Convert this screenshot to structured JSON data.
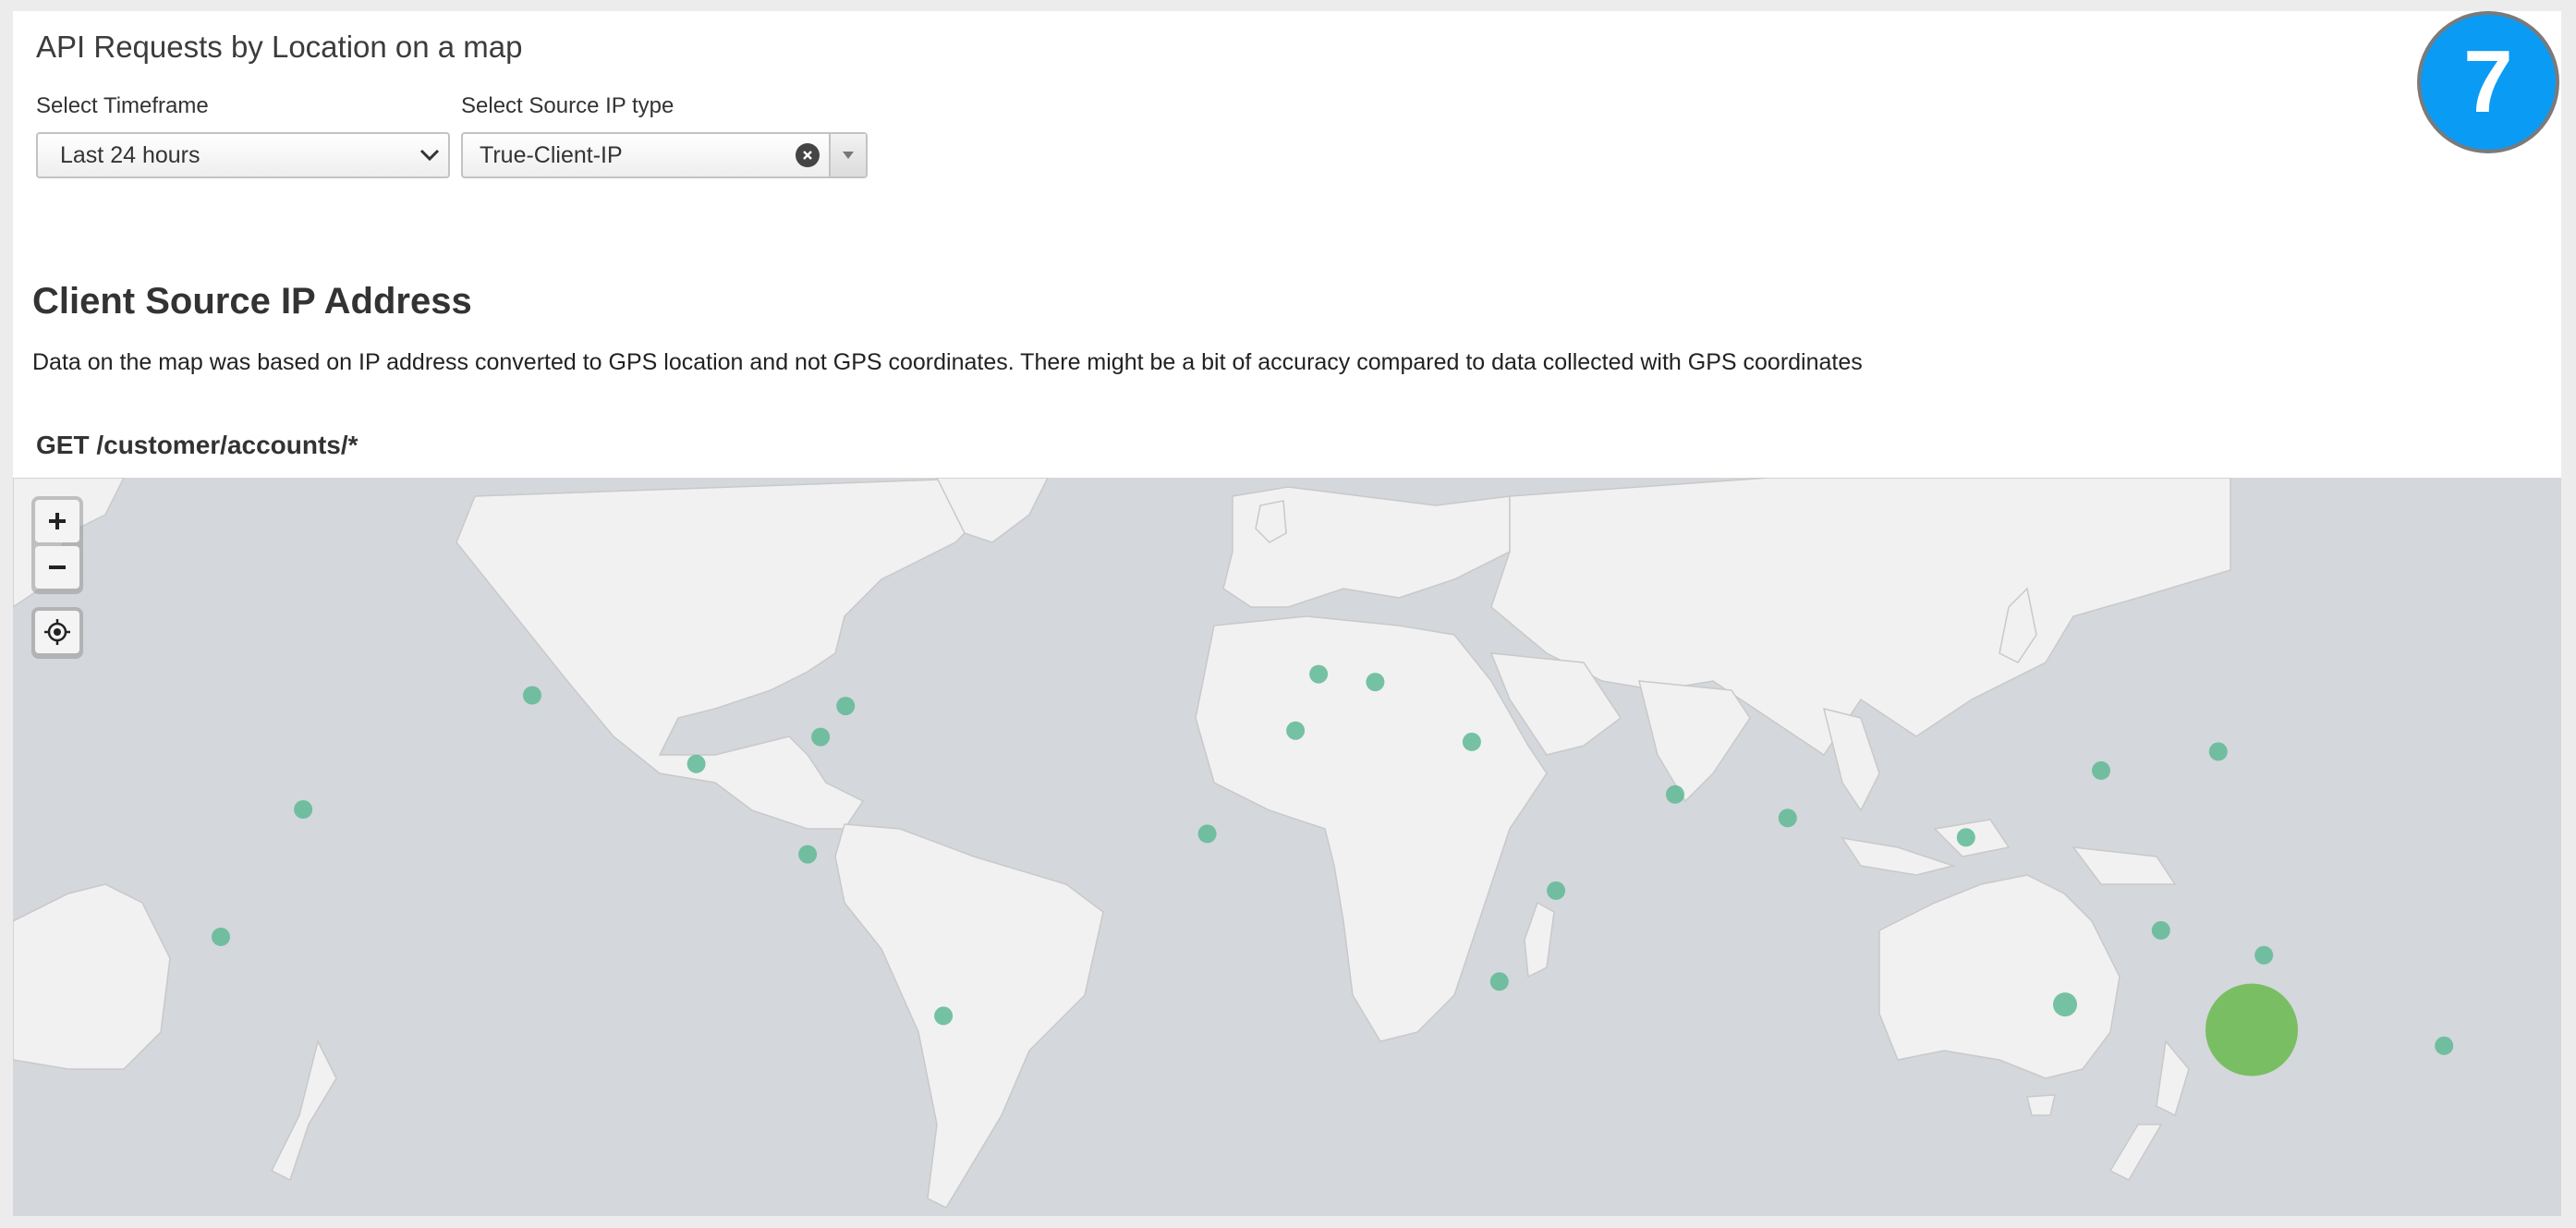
{
  "header": {
    "title": "API Requests by Location on a map",
    "badge": "7"
  },
  "inputs": {
    "timeframe": {
      "label": "Select Timeframe",
      "value": "Last 24 hours"
    },
    "source_ip": {
      "label": "Select Source IP type",
      "value": "True-Client-IP"
    }
  },
  "section": {
    "title": "Client Source IP Address",
    "description": "Data on the map was based on IP address converted to GPS location and not GPS coordinates. There might be a bit of accuracy compared to data collected with GPS coordinates"
  },
  "map": {
    "title": "GET /customer/accounts/*",
    "controls": {
      "zoom_in": "zoom-in-icon",
      "zoom_out": "zoom-out-icon",
      "locate": "locate-icon"
    },
    "colors": {
      "ocean": "#d4d7db",
      "land": "#f1f1f1",
      "marker": "#5fb895",
      "marker_large": "#6fbb55",
      "badge": "#0a9bf5"
    },
    "markers": [
      {
        "lat": 47.6,
        "lon": -122.3,
        "size": "small"
      },
      {
        "lat": 45.5,
        "lon": -73.6,
        "size": "small"
      },
      {
        "lat": 39.0,
        "lon": -77.5,
        "size": "small"
      },
      {
        "lat": 32.8,
        "lon": -96.8,
        "size": "small"
      },
      {
        "lat": 21.3,
        "lon": -157.9,
        "size": "small"
      },
      {
        "lat": 9.0,
        "lon": -79.5,
        "size": "small"
      },
      {
        "lat": -14.3,
        "lon": -170.7,
        "size": "small"
      },
      {
        "lat": -34.6,
        "lon": -58.4,
        "size": "small"
      },
      {
        "lat": 51.5,
        "lon": -0.1,
        "size": "small"
      },
      {
        "lat": 50.1,
        "lon": 8.7,
        "size": "small"
      },
      {
        "lat": 40.4,
        "lon": -3.7,
        "size": "small"
      },
      {
        "lat": 37.9,
        "lon": 23.7,
        "size": "small"
      },
      {
        "lat": 14.7,
        "lon": -17.4,
        "size": "small"
      },
      {
        "lat": 25.2,
        "lon": 55.3,
        "size": "small"
      },
      {
        "lat": 19.0,
        "lon": 72.8,
        "size": "small"
      },
      {
        "lat": -1.3,
        "lon": 36.8,
        "size": "small"
      },
      {
        "lat": -26.2,
        "lon": 28.0,
        "size": "small"
      },
      {
        "lat": 31.2,
        "lon": 121.5,
        "size": "small"
      },
      {
        "lat": 35.7,
        "lon": 139.7,
        "size": "small"
      },
      {
        "lat": 13.7,
        "lon": 100.5,
        "size": "small"
      },
      {
        "lat": -12.5,
        "lon": 130.8,
        "size": "small"
      },
      {
        "lat": -19.3,
        "lon": 146.8,
        "size": "small"
      },
      {
        "lat": -31.9,
        "lon": 115.9,
        "size": "medium"
      },
      {
        "lat": -37.8,
        "lon": 144.9,
        "size": "large"
      },
      {
        "lat": -41.3,
        "lon": 174.8,
        "size": "small"
      }
    ]
  }
}
